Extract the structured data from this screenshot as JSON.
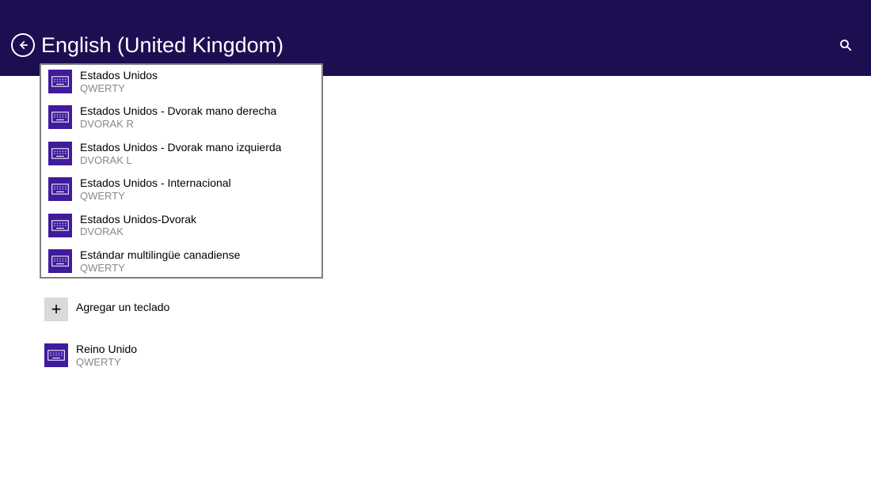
{
  "header": {
    "title": "English (United Kingdom)"
  },
  "dropdown": {
    "options": [
      {
        "name": "Estados Unidos",
        "layout": "QWERTY"
      },
      {
        "name": "Estados Unidos - Dvorak mano derecha",
        "layout": "DVORAK R"
      },
      {
        "name": "Estados Unidos - Dvorak mano izquierda",
        "layout": "DVORAK L"
      },
      {
        "name": "Estados Unidos - Internacional",
        "layout": "QWERTY"
      },
      {
        "name": "Estados Unidos-Dvorak",
        "layout": "DVORAK"
      },
      {
        "name": "Estándar multilingüe canadiense",
        "layout": "QWERTY"
      }
    ]
  },
  "add": {
    "label": "Agregar un teclado"
  },
  "installed": {
    "name": "Reino Unido",
    "layout": "QWERTY"
  }
}
